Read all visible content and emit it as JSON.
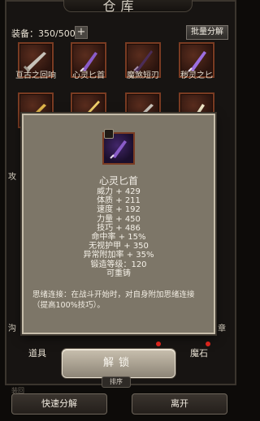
{
  "window": {
    "title": "仓库"
  },
  "toolbar": {
    "capacity": "装备：350/500",
    "add_label": "+",
    "batch_label": "批量分解"
  },
  "inventory": {
    "row1": [
      {
        "name": "亘古之回响",
        "icon": "rifle-icon"
      },
      {
        "name": "心灵匕首",
        "icon": "purple-dagger-icon"
      },
      {
        "name": "魔煞短刃",
        "icon": "dark-blade-icon"
      },
      {
        "name": "秽灵之匕",
        "icon": "violet-dagger-icon"
      }
    ],
    "row2_icons": [
      "golden-sword-icon",
      "golden-spear-icon",
      "silver-blade-icon",
      "bone-dagger-icon"
    ],
    "side_left": "攻",
    "side_left2": "沟",
    "side_right": "章"
  },
  "tooltip": {
    "item_name": "心灵匕首",
    "stats": [
      "威力 + 429",
      "体质 + 211",
      "速度 + 192",
      "力量 + 450",
      "技巧 + 486",
      "命中率 + 15%",
      "无视护甲 + 350",
      "异常附加率 + 35%",
      "锻造等级：120",
      "可重铸"
    ],
    "description": "思绪连接：在战斗开始时，对自身附加思绪连接（提高100%技巧）。"
  },
  "bottom": {
    "tab_left": "道具",
    "tab_right": "魔石",
    "unlock_label": "解锁",
    "sort_label": "排序",
    "ghost_label": "装回",
    "quick_decompose": "快速分解",
    "leave": "离开"
  },
  "colors": {
    "tooltip_bg": "#7d7668",
    "frame_border": "#7a3b22",
    "badge_red": "#d8241c"
  }
}
